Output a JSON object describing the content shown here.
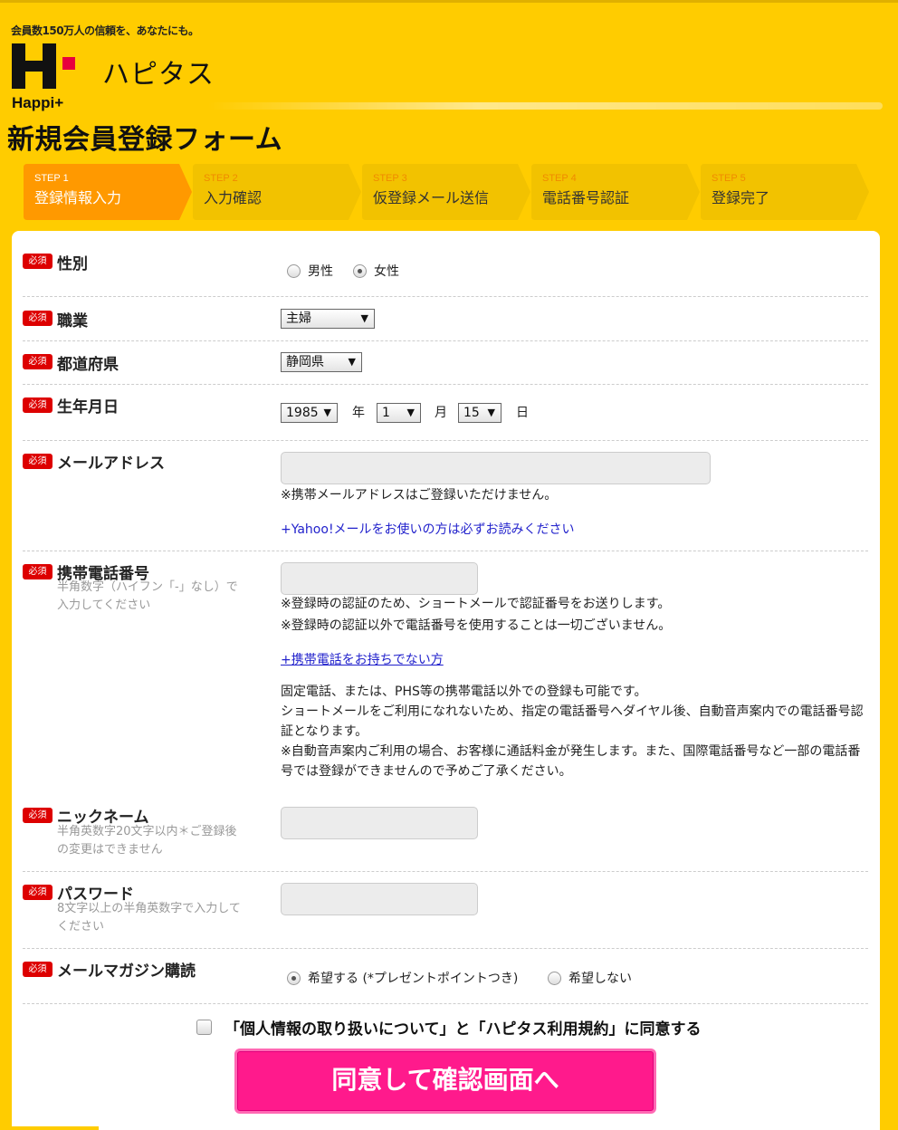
{
  "header": {
    "tagline": "会員数150万人の信頼を、あなたにも。",
    "logo_name": "ハピタス",
    "logo_sub": "Happi+",
    "page_title": "新規会員登録フォーム"
  },
  "steps": [
    {
      "num": "STEP 1",
      "label": "登録情報入力",
      "active": true
    },
    {
      "num": "STEP 2",
      "label": "入力確認",
      "active": false
    },
    {
      "num": "STEP 3",
      "label": "仮登録メール送信",
      "active": false
    },
    {
      "num": "STEP 4",
      "label": "電話番号認証",
      "active": false
    },
    {
      "num": "STEP 5",
      "label": "登録完了",
      "active": false
    }
  ],
  "required_badge": "必須",
  "form": {
    "gender": {
      "label": "性別",
      "options": [
        "男性",
        "女性"
      ],
      "selected": "女性"
    },
    "occupation": {
      "label": "職業",
      "value": "主婦"
    },
    "prefecture": {
      "label": "都道府県",
      "value": "静岡県"
    },
    "birthday": {
      "label": "生年月日",
      "year": "1985",
      "year_unit": "年",
      "month": "1",
      "month_unit": "月",
      "day": "15",
      "day_unit": "日"
    },
    "email": {
      "label": "メールアドレス",
      "value": "",
      "note": "※携帯メールアドレスはご登録いただけません。",
      "link": "+Yahoo!メールをお使いの方は必ずお読みください"
    },
    "phone": {
      "label": "携帯電話番号",
      "hint": "半角数字（ハイフン「-」なし）で入力してください",
      "value": "",
      "note1": "※登録時の認証のため、ショートメールで認証番号をお送りします。",
      "note2": "※登録時の認証以外で電話番号を使用することは一切ございません。",
      "link": "+携帯電話をお持ちでない方",
      "para1": "固定電話、または、PHS等の携帯電話以外での登録も可能です。",
      "para2": "ショートメールをご利用になれないため、指定の電話番号へダイヤル後、自動音声案内での電話番号認証となります。",
      "para3": "※自動音声案内ご利用の場合、お客様に通話料金が発生します。また、国際電話番号など一部の電話番号では登録ができませんので予めご了承ください。"
    },
    "nickname": {
      "label": "ニックネーム",
      "hint": "半角英数字20文字以内＊ご登録後の変更はできません",
      "value": ""
    },
    "password": {
      "label": "パスワード",
      "hint": "8文字以上の半角英数字で入力してください",
      "value": ""
    },
    "newsletter": {
      "label": "メールマガジン購読",
      "options": [
        "希望する (*プレゼントポイントつき)",
        "希望しない"
      ],
      "selected": "希望する (*プレゼントポイントつき)"
    },
    "agree_label": "「個人情報の取り扱いについて」と「ハピタス利用規約」に同意する",
    "submit_label": "同意して確認画面へ"
  },
  "colors": {
    "brand_yellow": "#ffcc00",
    "active_step": "#ff9900",
    "required_red": "#dd0000",
    "submit_pink": "#ff1a8c",
    "link_blue": "#2222cc"
  }
}
